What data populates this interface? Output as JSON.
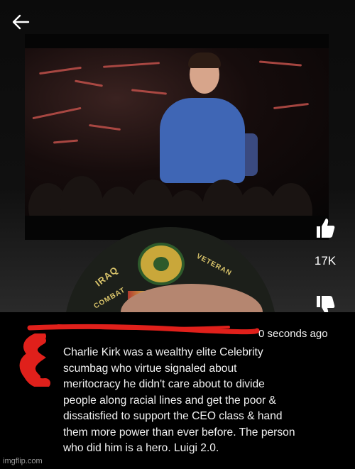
{
  "video": {
    "like_count": "17K"
  },
  "hat": {
    "text_top": "IRAQ",
    "text_left": "COMBAT",
    "text_right": "VETERAN"
  },
  "comment": {
    "timestamp": "0 seconds ago",
    "text": "Charlie Kirk was a wealthy elite Celebrity\nscumbag who virtue signaled about\nmeritocracy he didn't care about to divide\npeople along racial lines and get the poor &\ndissatisfied to support the CEO class & hand\nthem more power than ever before. The person\nwho did him is a hero. Luigi 2.0."
  },
  "watermark": "imgflip.com",
  "colors": {
    "redaction": "#e0201b",
    "background": "#000000",
    "text": "#f2f2f2",
    "suit": "#3f66b5"
  },
  "icons": [
    "back-arrow-icon",
    "thumbs-up-icon",
    "thumbs-down-icon"
  ]
}
